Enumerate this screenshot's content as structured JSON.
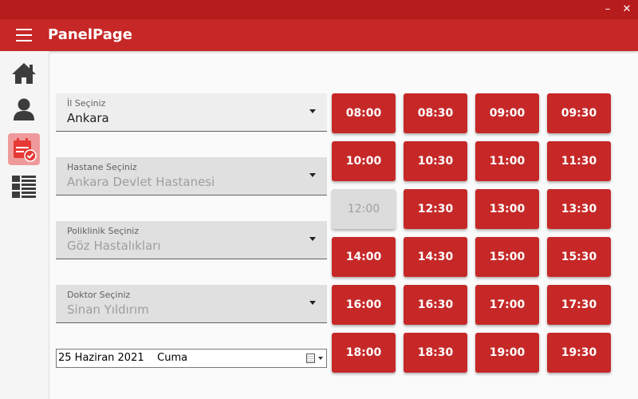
{
  "window": {
    "minimize_glyph": "–",
    "close_glyph": "✕"
  },
  "appbar": {
    "title": "PanelPage",
    "menu_icon": "hamburger-menu-icon"
  },
  "sidebar": {
    "items": [
      {
        "icon": "home-icon"
      },
      {
        "icon": "user-icon"
      },
      {
        "icon": "calendar-check-icon",
        "active": true
      },
      {
        "icon": "list-icon"
      }
    ]
  },
  "form": {
    "city": {
      "label": "İl Seçiniz",
      "value": "Ankara"
    },
    "hospital": {
      "label": "Hastane Seçiniz",
      "value": "Ankara Devlet Hastanesi"
    },
    "clinic": {
      "label": "Poliklinik Seçiniz",
      "value": "Göz Hastalıkları"
    },
    "doctor": {
      "label": "Doktor Seçiniz",
      "value": "Sinan Yıldırım"
    },
    "date": {
      "value": "25 Haziran 2021    Cuma"
    }
  },
  "slots": [
    {
      "time": "08:00",
      "available": true
    },
    {
      "time": "08:30",
      "available": true
    },
    {
      "time": "09:00",
      "available": true
    },
    {
      "time": "09:30",
      "available": true
    },
    {
      "time": "10:00",
      "available": true
    },
    {
      "time": "10:30",
      "available": true
    },
    {
      "time": "11:00",
      "available": true
    },
    {
      "time": "11:30",
      "available": true
    },
    {
      "time": "12:00",
      "available": false
    },
    {
      "time": "12:30",
      "available": true
    },
    {
      "time": "13:00",
      "available": true
    },
    {
      "time": "13:30",
      "available": true
    },
    {
      "time": "14:00",
      "available": true
    },
    {
      "time": "14:30",
      "available": true
    },
    {
      "time": "15:00",
      "available": true
    },
    {
      "time": "15:30",
      "available": true
    },
    {
      "time": "16:00",
      "available": true
    },
    {
      "time": "16:30",
      "available": true
    },
    {
      "time": "17:00",
      "available": true
    },
    {
      "time": "17:30",
      "available": true
    },
    {
      "time": "18:00",
      "available": true
    },
    {
      "time": "18:30",
      "available": true
    },
    {
      "time": "19:00",
      "available": true
    },
    {
      "time": "19:30",
      "available": true
    }
  ],
  "colors": {
    "primary": "#c62828",
    "titlebar": "#b71c1c",
    "disabled": "#dcdcdc",
    "active_nav": "#ef9a9a",
    "icon": "#3c3c3c"
  }
}
